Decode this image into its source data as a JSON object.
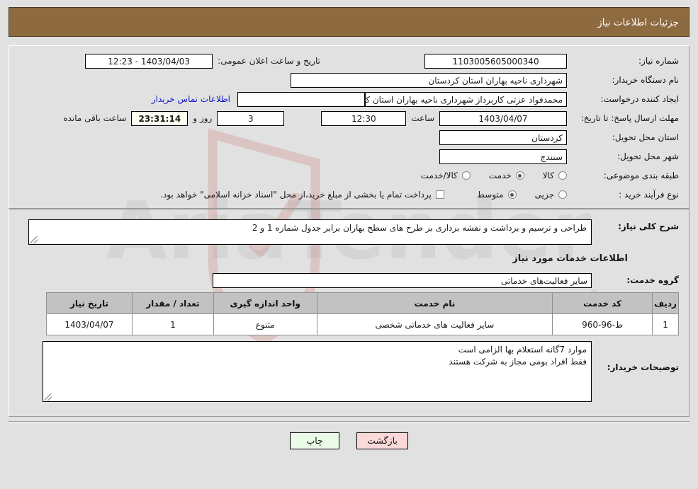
{
  "header": {
    "title": "جزئیات اطلاعات نیاز"
  },
  "form": {
    "need_number_label": "شماره نیاز:",
    "need_number_value": "1103005605000340",
    "public_announce_label": "تاریخ و ساعت اعلان عمومی:",
    "public_announce_value": "1403/04/03 - 12:23",
    "buyer_org_label": "نام دستگاه خریدار:",
    "buyer_org_value": "شهرداری ناحیه بهاران استان کردستان",
    "creator_label": "ایجاد کننده درخواست:",
    "creator_value": "محمدفواد عزتی کاربرداز شهرداری ناحیه بهاران استان کردستان",
    "contact_link": "اطلاعات تماس خریدار",
    "deadline_label": "مهلت ارسال پاسخ: تا تاریخ:",
    "deadline_value": "1403/04/07",
    "hour_label": "ساعت",
    "hour_value": "12:30",
    "days_value": "3",
    "days_text": "روز و",
    "remaining_value": "23:31:14",
    "remaining_text": "ساعت باقی مانده",
    "province_label": "استان محل تحویل:",
    "province_value": "کردستان",
    "city_label": "شهر محل تحویل:",
    "city_value": "سنندج",
    "category_label": "طبقه بندی موضوعی:",
    "category_options": [
      {
        "label": "کالا",
        "selected": false
      },
      {
        "label": "خدمت",
        "selected": true
      },
      {
        "label": "کالا/خدمت",
        "selected": false
      }
    ],
    "process_label": "نوع فرآیند خرید :",
    "process_options": [
      {
        "label": "جزیی",
        "selected": false
      },
      {
        "label": "متوسط",
        "selected": true
      }
    ],
    "treasury_checkbox_label": "پرداخت تمام یا بخشی از مبلغ خرید،از محل \"اسناد خزانه اسلامی\" خواهد بود.",
    "treasury_checked": false
  },
  "description": {
    "label": "شرح کلی نیاز:",
    "value": "طراحی و ترسیم و برداشت و نقشه برداری بر طرح های سطح بهاران برابر جدول شماره 1 و 2"
  },
  "services_section": {
    "title": "اطلاعات خدمات مورد نیاز",
    "group_label": "گروه خدمت:",
    "group_value": "سایر فعالیت‌های خدماتی"
  },
  "table": {
    "headers": [
      "ردیف",
      "کد خدمت",
      "نام خدمت",
      "واحد اندازه گیری",
      "تعداد / مقدار",
      "تاریخ نیاز"
    ],
    "rows": [
      {
        "radif": "1",
        "code": "ط-96-960",
        "name": "سایر فعالیت های خدماتی شخصی",
        "unit": "متنوع",
        "qty": "1",
        "date": "1403/04/07"
      }
    ]
  },
  "notes": {
    "label": "توضیحات خریدار:",
    "line1": "موارد 7گانه استعلام بها الزامی است",
    "line2": "فقط افراد بومی مجاز به شرکت هستند"
  },
  "footer": {
    "print_label": "چاپ",
    "back_label": "بازگشت"
  },
  "watermark": {
    "text": "AriaTender.net"
  },
  "colors": {
    "header_bg": "#8d6a3f",
    "page_bg": "#e1e1e1",
    "link": "#1414cc",
    "print_btn": "#eafbe7",
    "back_btn": "#fbd9d9",
    "table_header": "#c2c2c2"
  }
}
